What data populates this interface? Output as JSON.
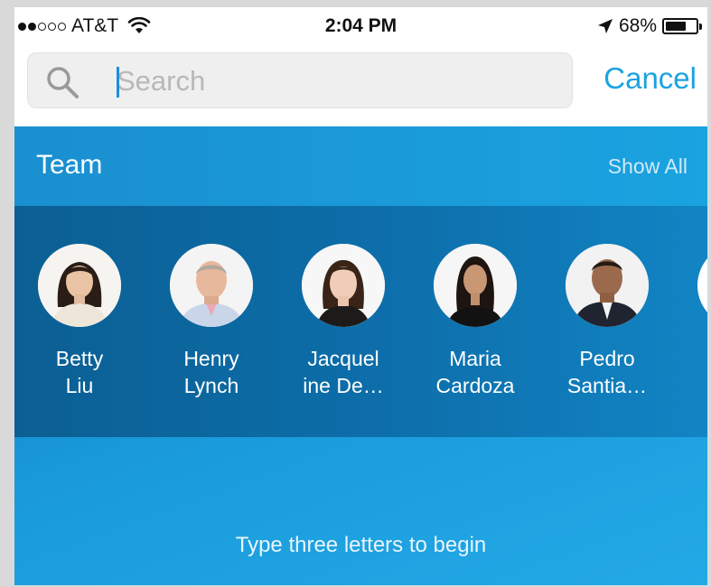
{
  "status_bar": {
    "carrier": "AT&T",
    "signal_bars_filled": 2,
    "signal_bars_total": 5,
    "time": "2:04 PM",
    "battery_percent": "68%",
    "battery_level": 0.68
  },
  "search": {
    "placeholder": "Search",
    "value": "",
    "cancel_label": "Cancel"
  },
  "team": {
    "title": "Team",
    "show_all_label": "Show All",
    "contacts": [
      {
        "name": "Betty\nLiu"
      },
      {
        "name": "Henry\nLynch"
      },
      {
        "name": "Jacquel\nine De…"
      },
      {
        "name": "Maria\nCardoza"
      },
      {
        "name": "Pedro\nSantia…"
      }
    ]
  },
  "hint": "Type three letters to begin",
  "colors": {
    "accent": "#1ca3e0",
    "panel_blue": "#1a9bdc",
    "band_dark": "#0b5f93"
  },
  "icons": {
    "search": "search-icon",
    "wifi": "wifi-icon",
    "location": "location-arrow-icon",
    "battery": "battery-icon"
  }
}
